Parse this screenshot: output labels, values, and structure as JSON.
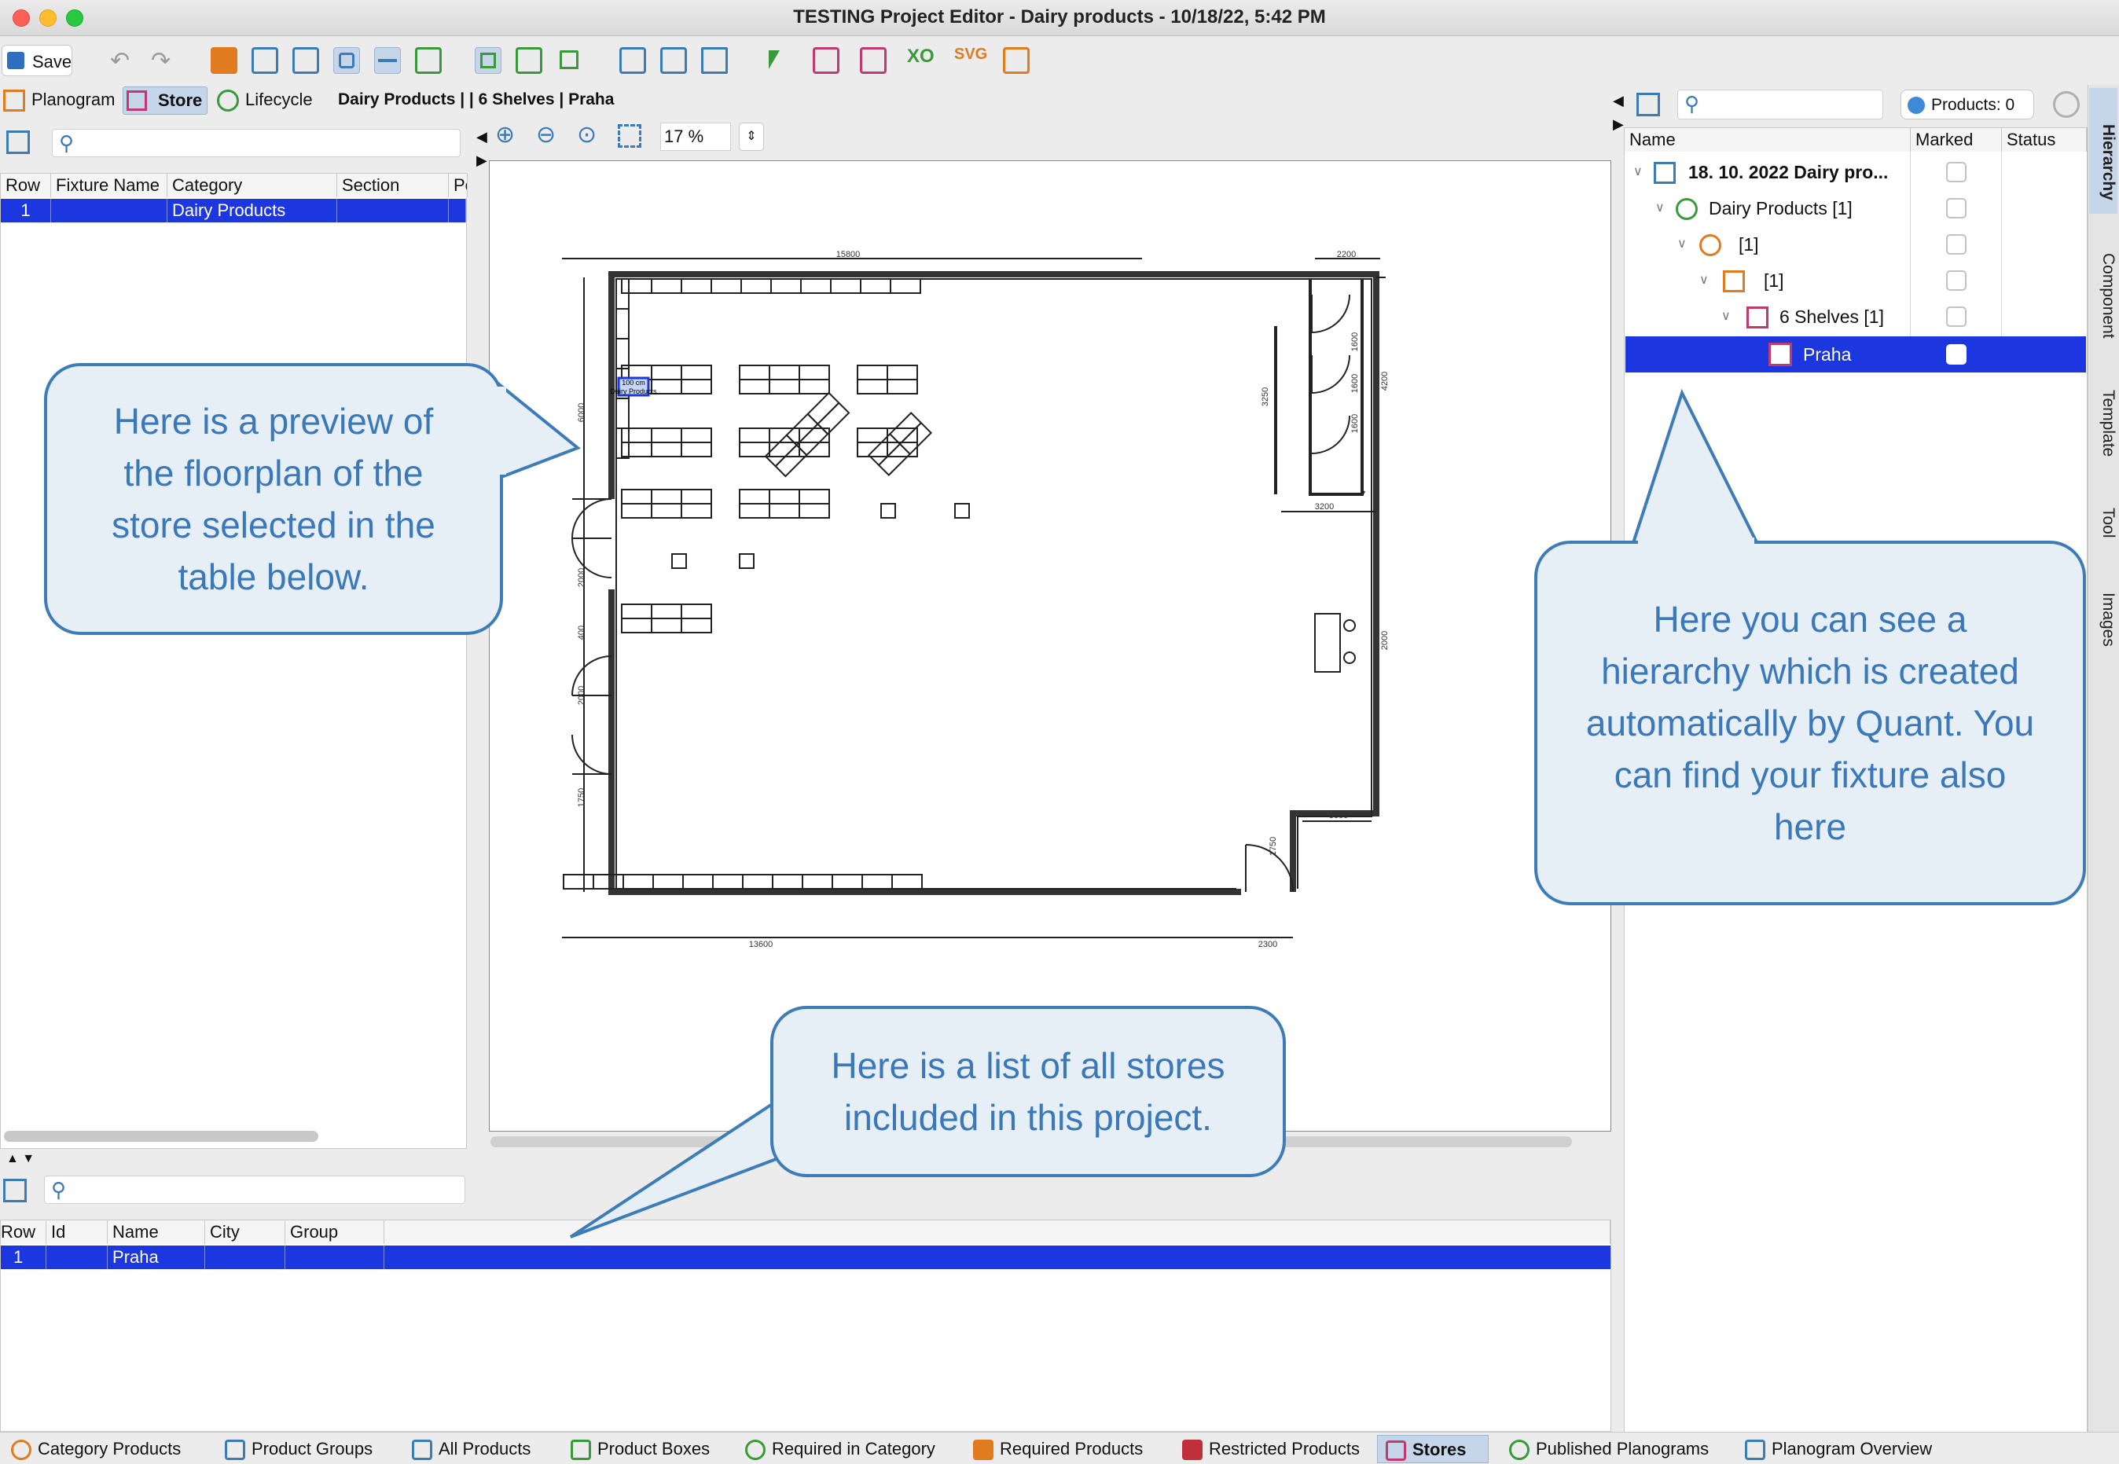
{
  "window": {
    "title": "TESTING Project Editor - Dairy products - 10/18/22, 5:42 PM"
  },
  "toolbar": {
    "save_label": "Save"
  },
  "nav": {
    "tabs": [
      {
        "label": "Planogram"
      },
      {
        "label": "Store"
      },
      {
        "label": "Lifecycle"
      }
    ],
    "breadcrumb": "Dairy Products | | 6 Shelves | Praha"
  },
  "fixtures_table": {
    "columns": [
      "Row",
      "Fixture Name",
      "Category",
      "Section",
      "Po"
    ],
    "rows": [
      {
        "row": "1",
        "fixture_name": "",
        "category": "Dairy Products",
        "section": "",
        "po": ""
      }
    ]
  },
  "zoom": {
    "value": "17 %"
  },
  "floorplan": {
    "dimensions": {
      "top_width": "15800",
      "top_right": "2200",
      "bottom_width": "13600",
      "door_width": "2300",
      "right_bottom": "3000",
      "room_width": "3200",
      "left_height": "6000",
      "left_mid": "2000",
      "left_small": "400",
      "left_lower": "2000",
      "left_bottom": "1750",
      "right_height": "4200",
      "right_mid": "2000",
      "room_height": "3250",
      "door_a": "1600",
      "door_b": "1600",
      "door_c": "1600",
      "entry_height": "1750"
    },
    "selected_fixture_line1": "100 cm",
    "selected_fixture_line2": "Dairy Products"
  },
  "stores_table": {
    "columns": [
      "Row",
      "Id",
      "Name",
      "City",
      "Group"
    ],
    "rows": [
      {
        "row": "1",
        "id": "",
        "name": "Praha",
        "city": "",
        "group": ""
      }
    ]
  },
  "hierarchy": {
    "filter_label": "Products: 0",
    "columns": [
      "Name",
      "Marked",
      "Status"
    ],
    "nodes": [
      {
        "label": "18. 10. 2022 Dairy pro...",
        "level": 0
      },
      {
        "label": "Dairy Products [1]",
        "level": 1
      },
      {
        "label": "[1]",
        "level": 2
      },
      {
        "label": "[1]",
        "level": 3
      },
      {
        "label": "6 Shelves [1]",
        "level": 4
      },
      {
        "label": "Praha",
        "level": 5,
        "selected": true
      }
    ]
  },
  "side_tabs": [
    "Hierarchy",
    "Component",
    "Template",
    "Tool",
    "Images"
  ],
  "callouts": {
    "floorplan": "Here is a preview of the floorplan of the store selected in the table below.",
    "hierarchy": "Here you can see a hierarchy which is created automatically by Quant. You can find your fixture also here",
    "stores": "Here is a list of all stores included in this project."
  },
  "bottom_tabs": [
    {
      "label": "Category Products"
    },
    {
      "label": "Product Groups"
    },
    {
      "label": "All Products"
    },
    {
      "label": "Product Boxes"
    },
    {
      "label": "Required in Category"
    },
    {
      "label": "Required Products"
    },
    {
      "label": "Restricted Products"
    },
    {
      "label": "Stores"
    },
    {
      "label": "Published Planograms"
    },
    {
      "label": "Planogram Overview"
    }
  ],
  "colors": {
    "selection": "#1c36e0",
    "callout_border": "#3e7cb8",
    "callout_fill": "#e6eef6",
    "callout_text": "#3a78b9",
    "accent_orange": "#e07b20",
    "accent_blue": "#3d7ab8",
    "accent_green": "#3a9a3a"
  }
}
